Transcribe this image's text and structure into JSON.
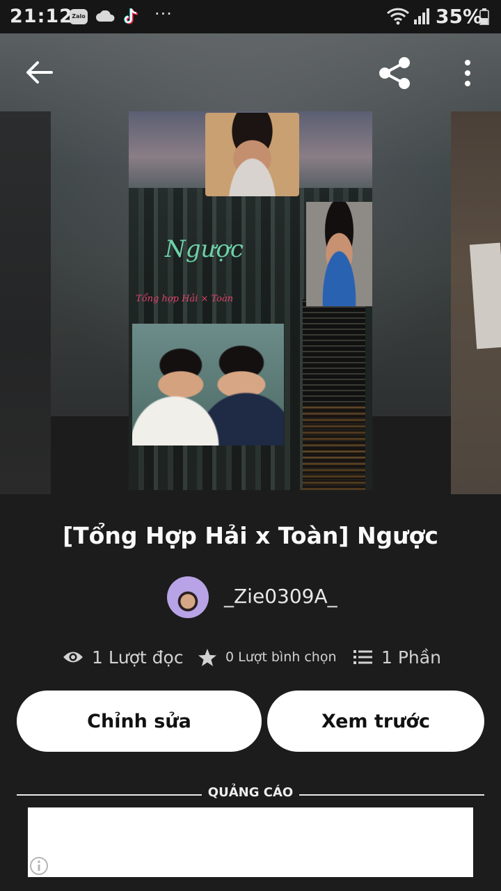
{
  "status_bar": {
    "time": "21:12",
    "zalo_label": "Zalo",
    "overflow": "···",
    "battery": "35%"
  },
  "cover": {
    "title": "Ngược",
    "subtitle": "Tổng hợp Hải × Toàn"
  },
  "story": {
    "title": "[Tổng Hợp Hải x Toàn] Ngược",
    "author": "_Zie0309A_"
  },
  "stats": {
    "reads": "1 Lượt đọc",
    "votes": "0 Lượt bình chọn",
    "parts": "1 Phần"
  },
  "actions": {
    "edit": "Chỉnh sửa",
    "preview": "Xem trước"
  },
  "ad": {
    "label": "QUẢNG CÁO"
  },
  "colors": {
    "background": "#1c1c1c",
    "button_bg": "#ffffff",
    "cover_title": "#6ed1a8",
    "cover_subtitle": "#e0446c"
  }
}
